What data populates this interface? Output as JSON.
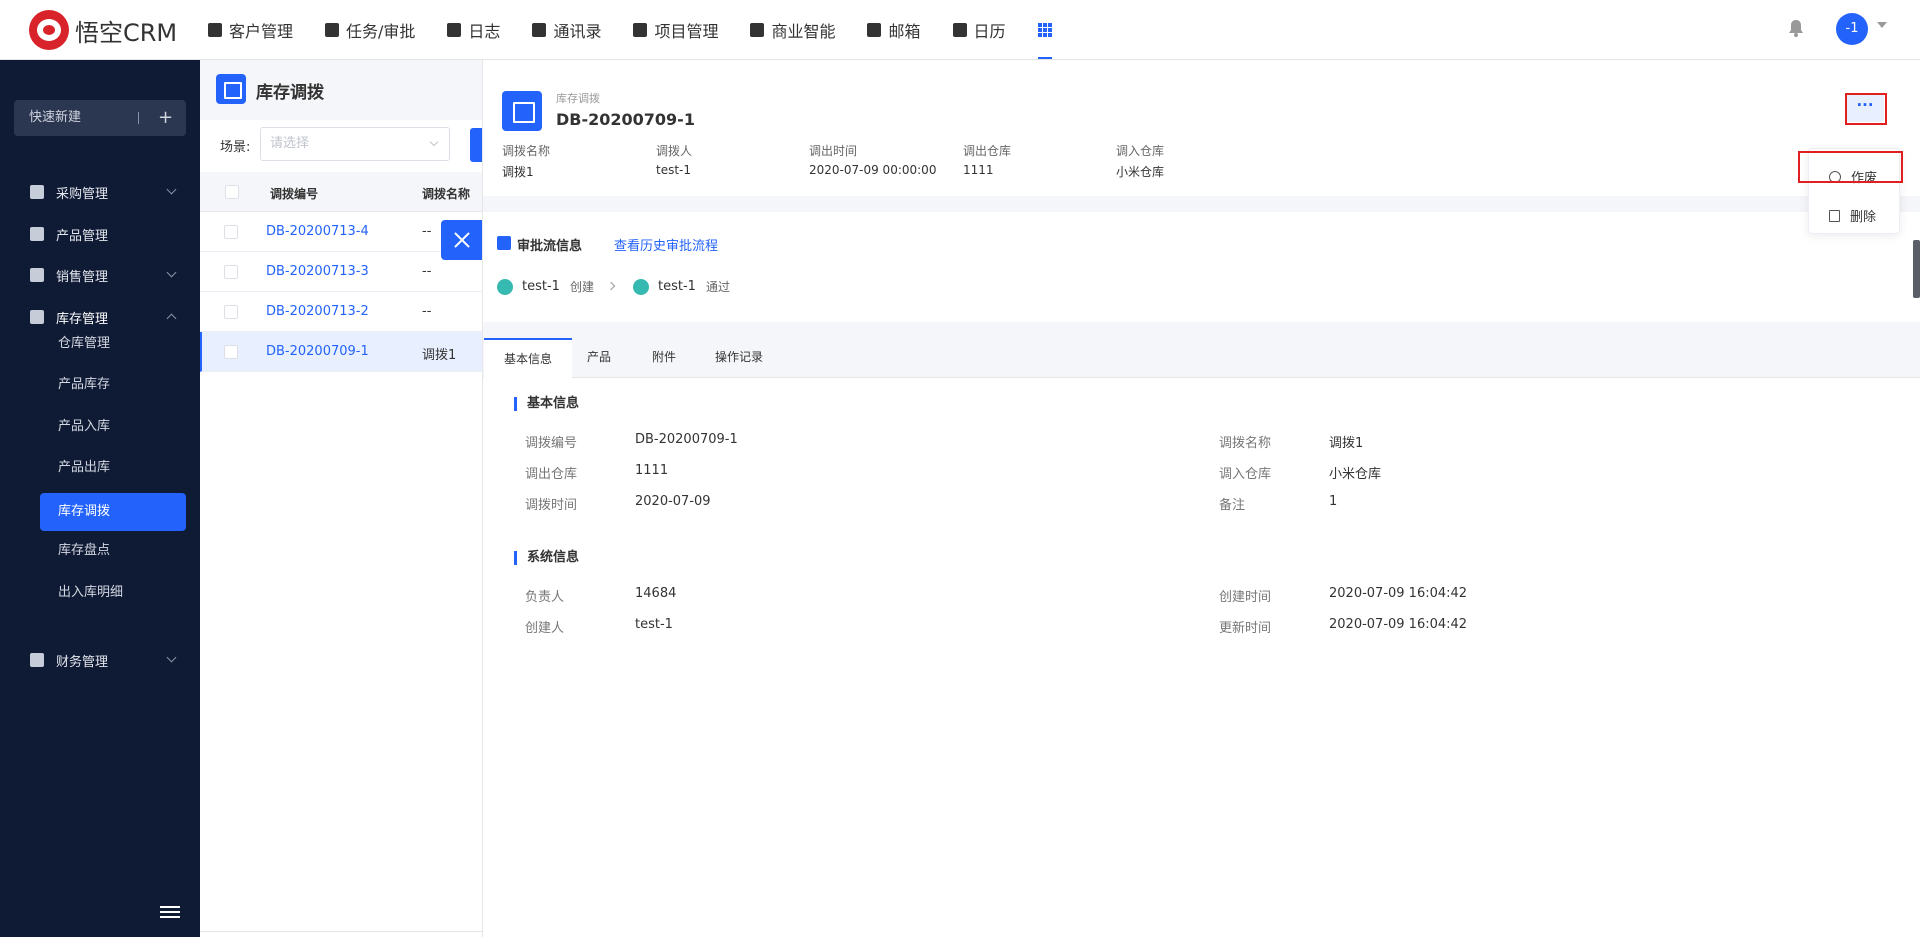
{
  "app": {
    "logo_text": "悟空CRM"
  },
  "nav": [
    {
      "label": "客户管理",
      "icon": "customer-icon"
    },
    {
      "label": "任务/审批",
      "icon": "briefcase-icon"
    },
    {
      "label": "日志",
      "icon": "log-icon"
    },
    {
      "label": "通讯录",
      "icon": "contacts-icon"
    },
    {
      "label": "项目管理",
      "icon": "project-icon"
    },
    {
      "label": "商业智能",
      "icon": "bi-icon"
    },
    {
      "label": "邮箱",
      "icon": "mail-icon"
    },
    {
      "label": "日历",
      "icon": "calendar-icon"
    }
  ],
  "user": {
    "avatar_text": "-1"
  },
  "sidebar": {
    "quick_new": "快速新建",
    "quick_plus": "+",
    "menu": [
      {
        "label": "采购管理",
        "icon": "cart-icon"
      },
      {
        "label": "产品管理",
        "icon": "box-icon"
      },
      {
        "label": "销售管理",
        "icon": "tag-icon"
      },
      {
        "label": "库存管理",
        "icon": "archive-icon"
      },
      {
        "label": "财务管理",
        "icon": "wallet-icon"
      }
    ],
    "sub_items": [
      "仓库管理",
      "产品库存",
      "产品入库",
      "产品出库",
      "库存调拨",
      "库存盘点",
      "出入库明细"
    ],
    "active_sub": "库存调拨"
  },
  "list": {
    "title": "库存调拨",
    "scene_label": "场景:",
    "scene_placeholder": "请选择",
    "columns": [
      "调拨编号",
      "调拨名称"
    ],
    "rows": [
      {
        "code": "DB-20200713-4",
        "name": "--"
      },
      {
        "code": "DB-20200713-3",
        "name": "--"
      },
      {
        "code": "DB-20200713-2",
        "name": "--"
      },
      {
        "code": "DB-20200709-1",
        "name": "调拨1"
      }
    ]
  },
  "detail": {
    "subtitle": "库存调拨",
    "title": "DB-20200709-1",
    "more_label": "···",
    "header_fields": [
      {
        "label": "调拨名称",
        "value": "调拨1"
      },
      {
        "label": "调拨人",
        "value": "test-1"
      },
      {
        "label": "调出时间",
        "value": "2020-07-09 00:00:00"
      },
      {
        "label": "调出仓库",
        "value": "1111"
      },
      {
        "label": "调入仓库",
        "value": "小米仓库"
      }
    ],
    "dropdown": {
      "void": "作废",
      "delete": "删除"
    },
    "approval": {
      "title": "审批流信息",
      "history_link": "查看历史审批流程",
      "steps": [
        {
          "user": "test-1",
          "action": "创建"
        },
        {
          "user": "test-1",
          "action": "通过"
        }
      ]
    },
    "tabs": [
      "基本信息",
      "产品",
      "附件",
      "操作记录"
    ],
    "basic": {
      "title": "基本信息",
      "fields": [
        {
          "label": "调拨编号",
          "value": "DB-20200709-1"
        },
        {
          "label": "调拨名称",
          "value": "调拨1"
        },
        {
          "label": "调出仓库",
          "value": "1111"
        },
        {
          "label": "调入仓库",
          "value": "小米仓库"
        },
        {
          "label": "调拨时间",
          "value": "2020-07-09"
        },
        {
          "label": "备注",
          "value": "1"
        }
      ]
    },
    "system": {
      "title": "系统信息",
      "fields": [
        {
          "label": "负责人",
          "value": "14684"
        },
        {
          "label": "创建时间",
          "value": "2020-07-09 16:04:42"
        },
        {
          "label": "创建人",
          "value": "test-1"
        },
        {
          "label": "更新时间",
          "value": "2020-07-09 16:04:42"
        }
      ]
    }
  },
  "colors": {
    "accent": "#2362fb",
    "sidebar_bg": "#0f1a35",
    "highlight": "#e02020",
    "approval_dot": "#36b9b0"
  }
}
